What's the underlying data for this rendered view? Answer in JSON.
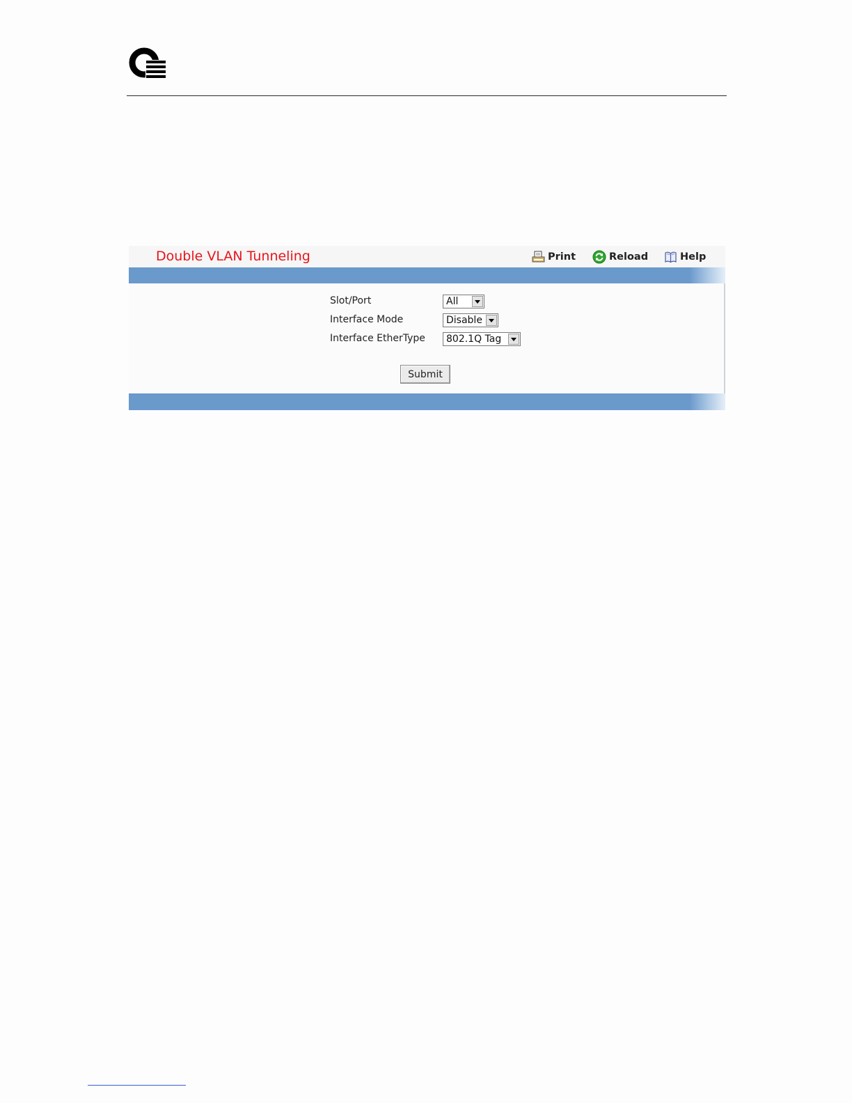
{
  "page": {
    "title": "Double VLAN Tunneling"
  },
  "toolbar": {
    "print_label": "Print",
    "reload_label": "Reload",
    "help_label": "Help"
  },
  "icons": {
    "logo": "q-logo-icon",
    "print": "printer-icon",
    "reload": "reload-icon",
    "help": "book-help-icon",
    "dropdown": "chevron-down-icon"
  },
  "form": {
    "slot_port": {
      "label": "Slot/Port",
      "value": "All"
    },
    "interface_mode": {
      "label": "Interface Mode",
      "value": "Disable"
    },
    "interface_ethertype": {
      "label": "Interface EtherType",
      "value": "802.1Q Tag"
    },
    "submit_label": "Submit"
  },
  "colors": {
    "title": "#e8141b",
    "band": "#6a99cb",
    "reload_icon": "#2fa52f"
  }
}
